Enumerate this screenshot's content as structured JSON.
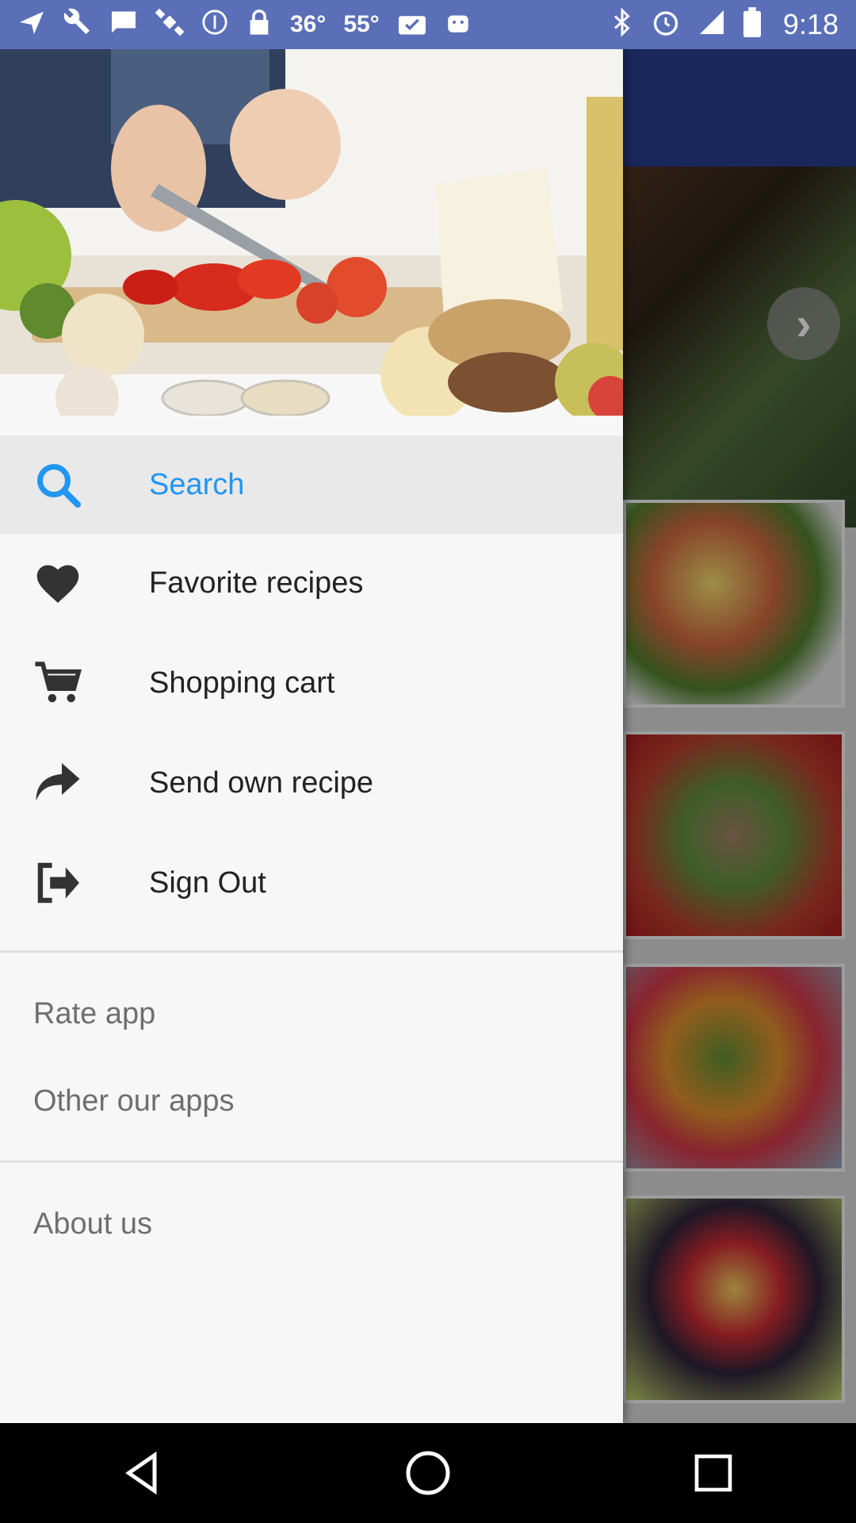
{
  "status_bar": {
    "temperature_1": "36°",
    "temperature_2": "55°",
    "time": "9:18",
    "icons": [
      "navigation-icon",
      "wrench-icon",
      "message-icon",
      "satellite-icon",
      "info-icon",
      "lock-icon",
      "photo-check-icon",
      "android-icon",
      "bluetooth-icon",
      "alarm-icon",
      "signal-icon",
      "battery-icon"
    ]
  },
  "drawer": {
    "menu": [
      {
        "label": "Search",
        "icon": "search-icon",
        "active": true
      },
      {
        "label": "Favorite recipes",
        "icon": "heart-icon",
        "active": false
      },
      {
        "label": "Shopping cart",
        "icon": "cart-icon",
        "active": false
      },
      {
        "label": "Send own recipe",
        "icon": "share-arrow-icon",
        "active": false
      },
      {
        "label": "Sign Out",
        "icon": "sign-out-icon",
        "active": false
      }
    ],
    "secondary": [
      {
        "label": "Rate app"
      },
      {
        "label": "Other our apps"
      }
    ],
    "tertiary": [
      {
        "label": "About us"
      }
    ]
  },
  "colors": {
    "status_bar": "#5a6fb8",
    "app_toolbar": "#273a86",
    "accent": "#2196f3",
    "drawer_bg": "#f7f7f7"
  },
  "nav_bar": {
    "buttons": [
      "back-icon",
      "home-icon",
      "recents-icon"
    ]
  }
}
